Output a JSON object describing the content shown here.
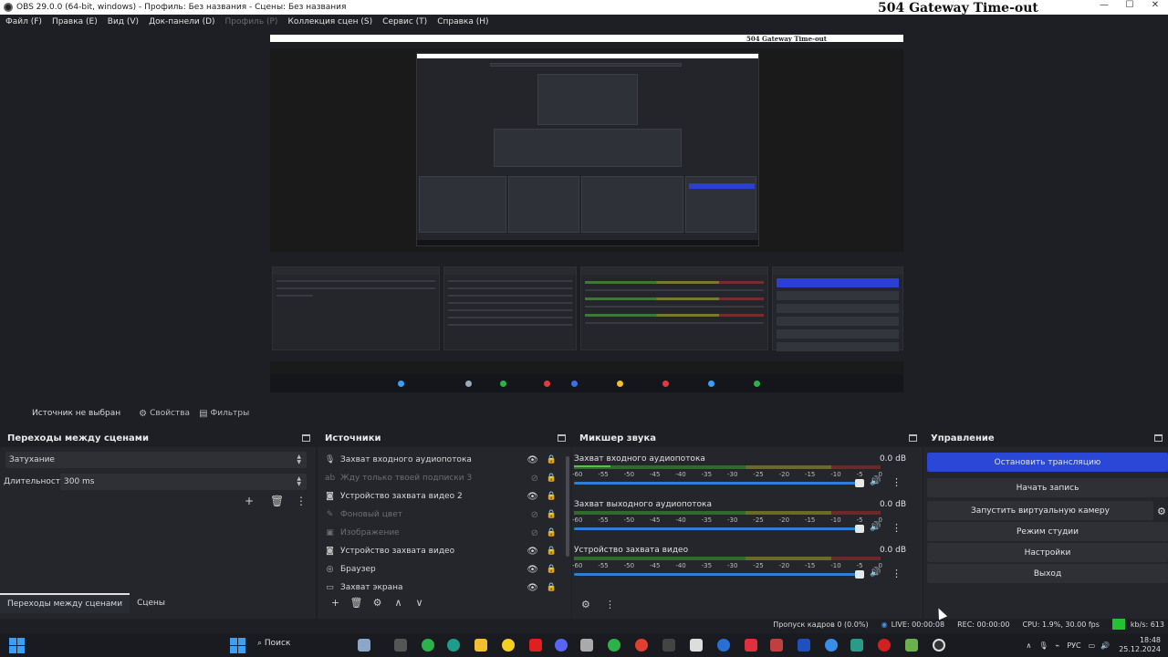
{
  "window": {
    "title": "OBS 29.0.0 (64-bit, windows) - Профиль: Без названия - Сцены: Без названия",
    "overlay_text": "504 Gateway Time-out",
    "controls": [
      "—",
      "☐",
      "✕"
    ]
  },
  "menu": [
    {
      "label": "Файл (F)",
      "disabled": false
    },
    {
      "label": "Правка (E)",
      "disabled": false
    },
    {
      "label": "Вид (V)",
      "disabled": false
    },
    {
      "label": "Док-панели (D)",
      "disabled": false
    },
    {
      "label": "Профиль (P)",
      "disabled": true
    },
    {
      "label": "Коллекция сцен (S)",
      "disabled": false
    },
    {
      "label": "Сервис (T)",
      "disabled": false
    },
    {
      "label": "Справка (H)",
      "disabled": false
    }
  ],
  "preview": {
    "inner_title": "504 Gateway Time-out"
  },
  "source_bar": {
    "no_source": "Источник не выбран",
    "properties": "Свойства",
    "filters": "Фильтры"
  },
  "transitions": {
    "title": "Переходы между сценами",
    "selected": "Затухание",
    "duration_label": "Длительность",
    "duration_value": "300 ms",
    "tabs": [
      "Переходы между сценами",
      "Сцены"
    ]
  },
  "sources": {
    "title": "Источники",
    "items": [
      {
        "name": "Захват входного аудиопотока",
        "icon": "mic-icon",
        "visible": true
      },
      {
        "name": "Жду только твоей подписки 3",
        "icon": "text-icon",
        "visible": false
      },
      {
        "name": "Устройство захвата видео 2",
        "icon": "camera-icon",
        "visible": true
      },
      {
        "name": "Фоновый цвет",
        "icon": "brush-icon",
        "visible": false
      },
      {
        "name": "Изображение",
        "icon": "image-icon",
        "visible": false
      },
      {
        "name": "Устройство захвата видео",
        "icon": "camera-icon",
        "visible": true
      },
      {
        "name": "Браузер",
        "icon": "globe-icon",
        "visible": true
      },
      {
        "name": "Захват экрана",
        "icon": "monitor-icon",
        "visible": true
      }
    ]
  },
  "mixer": {
    "title": "Микшер звука",
    "ticks": [
      "-60",
      "-55",
      "-50",
      "-45",
      "-40",
      "-35",
      "-30",
      "-25",
      "-20",
      "-15",
      "-10",
      "-5",
      "0"
    ],
    "channels": [
      {
        "name": "Захват входного аудиопотока",
        "db": "0.0 dB",
        "level": 0.12
      },
      {
        "name": "Захват выходного аудиопотока",
        "db": "0.0 dB",
        "level": 0
      },
      {
        "name": "Устройство захвата видео",
        "db": "0.0 dB",
        "level": 0
      }
    ]
  },
  "controls": {
    "title": "Управление",
    "stop_stream": "Остановить трансляцию",
    "start_record": "Начать запись",
    "virtual_cam": "Запустить виртуальную камеру",
    "studio_mode": "Режим студии",
    "settings": "Настройки",
    "exit": "Выход"
  },
  "status": {
    "dropped": "Пропуск кадров 0 (0.0%)",
    "live": "LIVE: 00:00:08",
    "rec": "REC: 00:00:00",
    "cpu": "CPU: 1.9%, 30.00 fps",
    "kbs": "kb/s: 613"
  },
  "taskbar": {
    "search": "Поиск",
    "lang": "РУС",
    "time": "18:48",
    "date": "25.12.2024"
  },
  "colors": {
    "accent": "#2b47d8",
    "meter_green": "#59c24c",
    "status_green": "#23c233"
  }
}
